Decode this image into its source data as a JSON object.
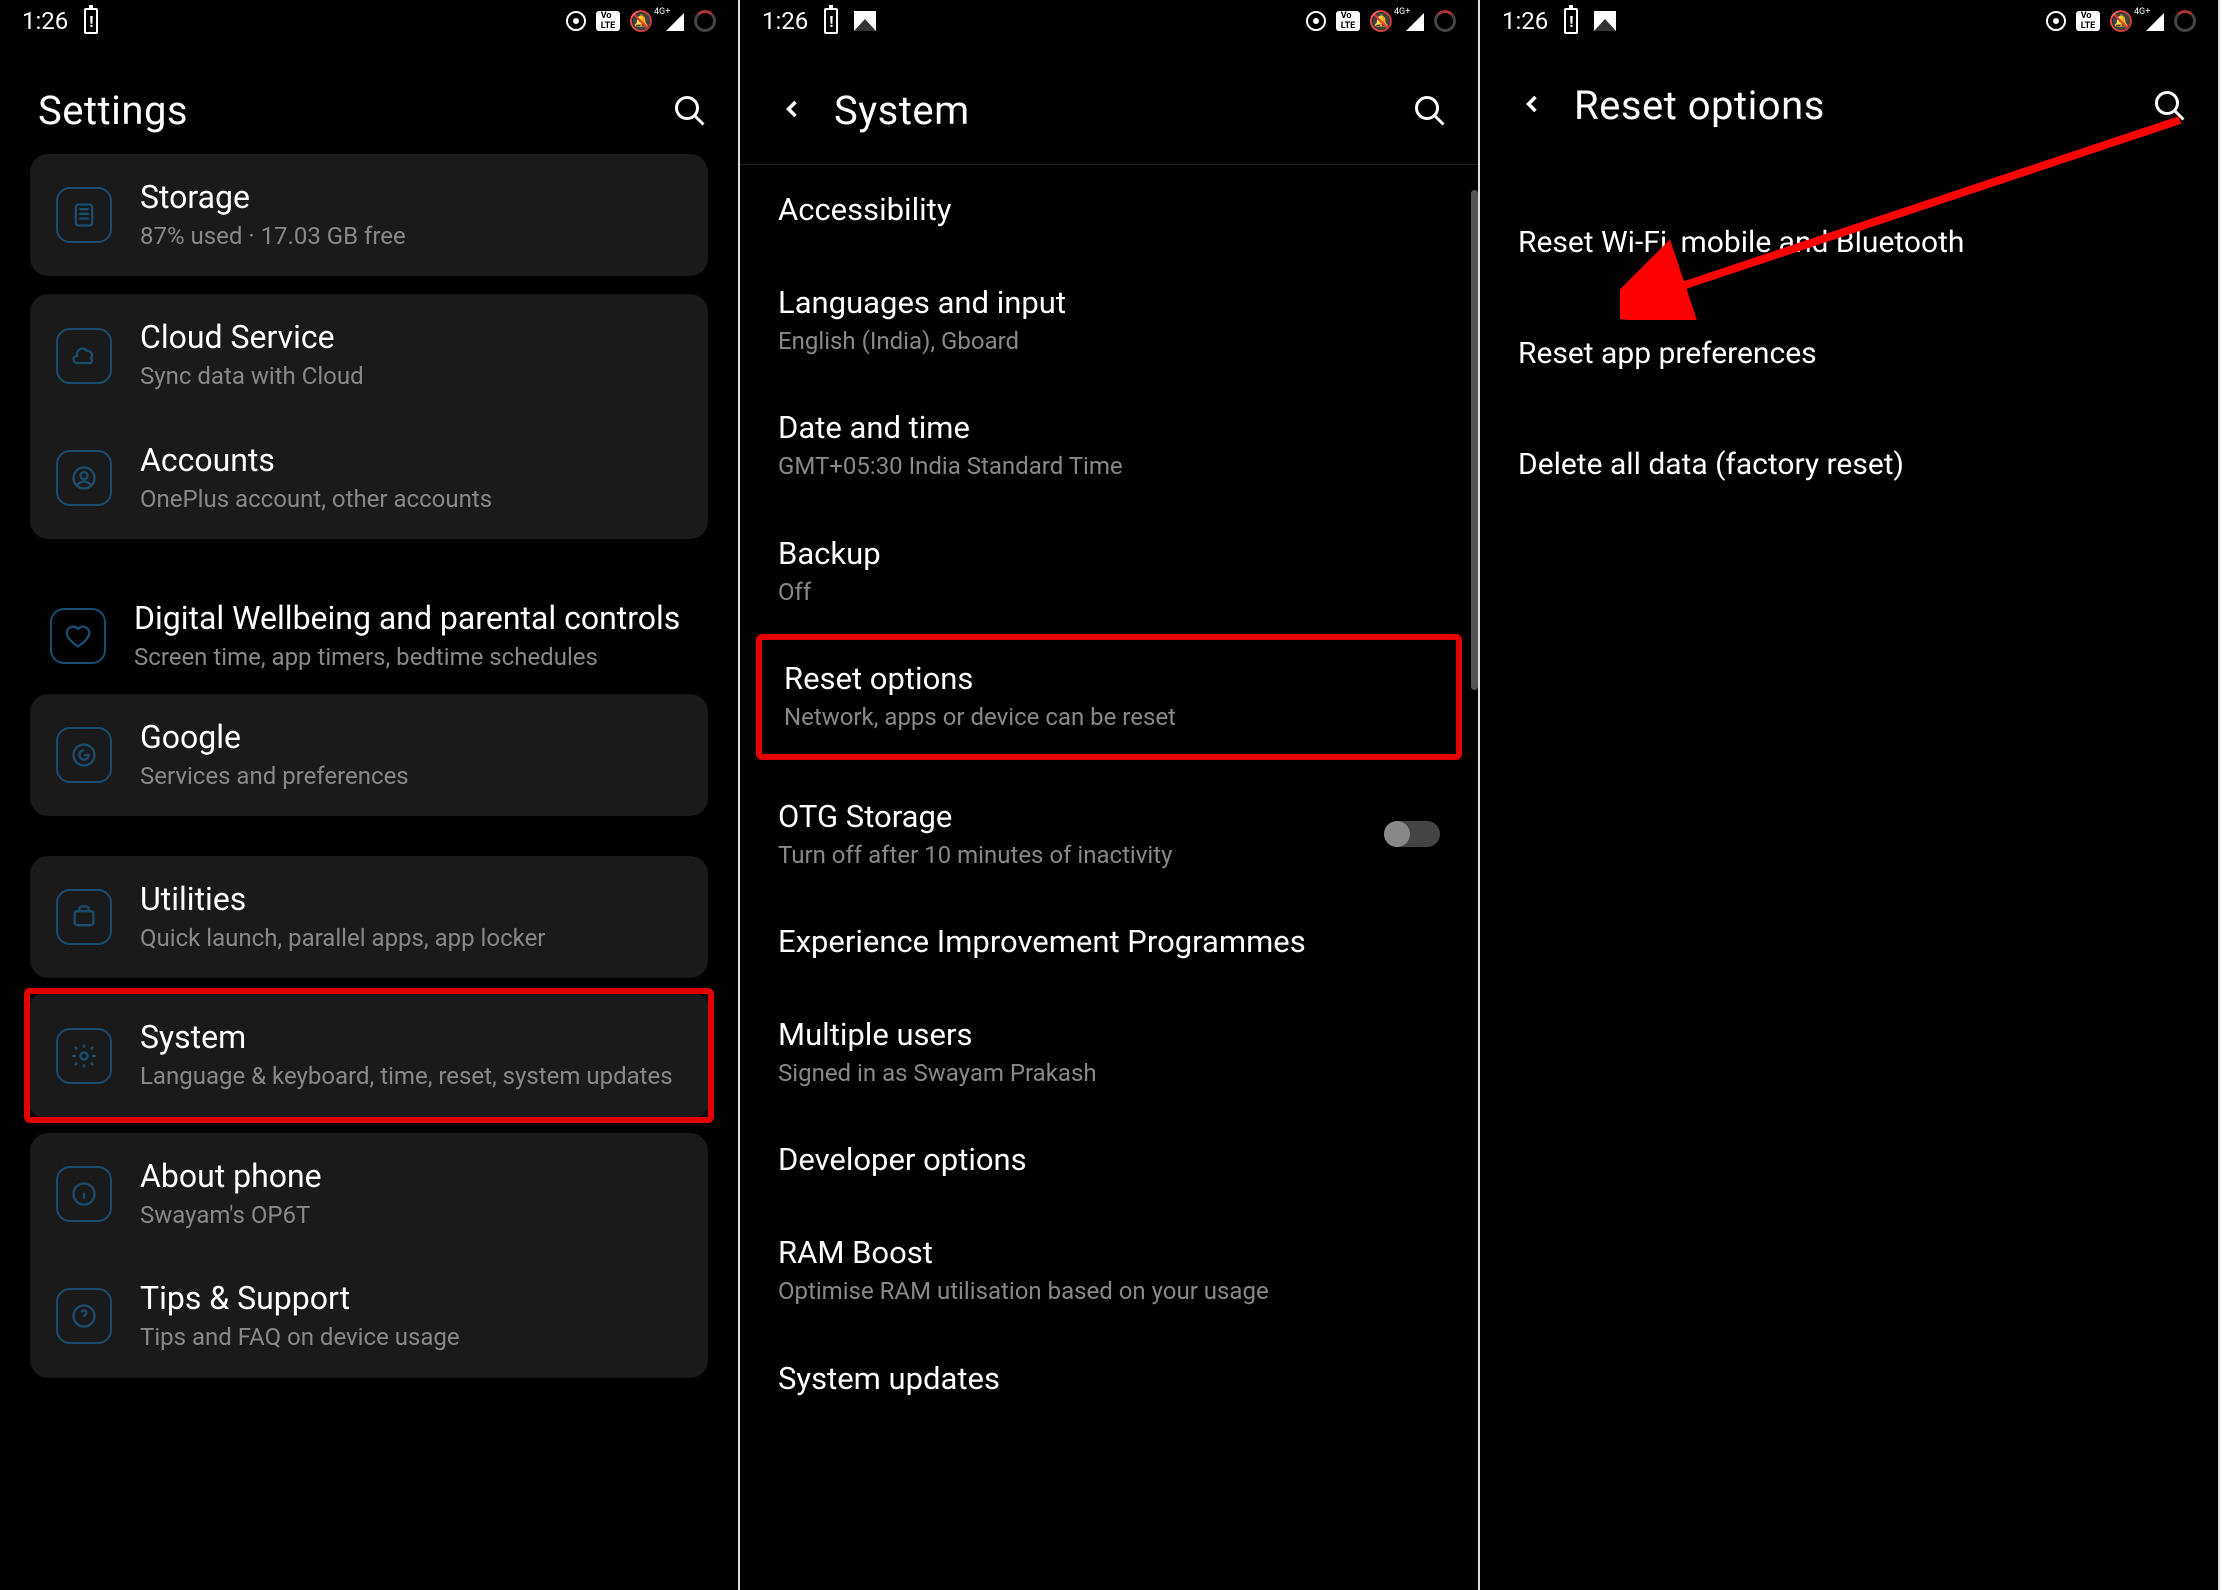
{
  "status_time": "1:26",
  "status": {
    "volte_label": "Vo\nLTE",
    "signal_label": "4G+"
  },
  "screens": {
    "settings": {
      "title": "Settings",
      "items": {
        "storage": {
          "title": "Storage",
          "subtitle": "87% used · 17.03 GB free"
        },
        "cloud": {
          "title": "Cloud Service",
          "subtitle": "Sync data with Cloud"
        },
        "accounts": {
          "title": "Accounts",
          "subtitle": "OnePlus account, other accounts"
        },
        "wellbeing": {
          "title": "Digital Wellbeing and parental controls",
          "subtitle": "Screen time, app timers, bedtime schedules"
        },
        "google": {
          "title": "Google",
          "subtitle": "Services and preferences"
        },
        "utilities": {
          "title": "Utilities",
          "subtitle": "Quick launch, parallel apps, app locker"
        },
        "system": {
          "title": "System",
          "subtitle": "Language & keyboard, time, reset, system updates"
        },
        "about": {
          "title": "About phone",
          "subtitle": "Swayam's OP6T"
        },
        "tips": {
          "title": "Tips & Support",
          "subtitle": "Tips and FAQ on device usage"
        }
      }
    },
    "system": {
      "title": "System",
      "items": {
        "accessibility": {
          "title": "Accessibility"
        },
        "languages": {
          "title": "Languages and input",
          "subtitle": "English (India), Gboard"
        },
        "datetime": {
          "title": "Date and time",
          "subtitle": "GMT+05:30 India Standard Time"
        },
        "backup": {
          "title": "Backup",
          "subtitle": "Off"
        },
        "reset": {
          "title": "Reset options",
          "subtitle": "Network, apps or device can be reset"
        },
        "otg": {
          "title": "OTG Storage",
          "subtitle": "Turn off after 10 minutes of inactivity"
        },
        "experience": {
          "title": "Experience Improvement Programmes"
        },
        "users": {
          "title": "Multiple users",
          "subtitle": "Signed in as Swayam Prakash"
        },
        "developer": {
          "title": "Developer options"
        },
        "ramboost": {
          "title": "RAM Boost",
          "subtitle": "Optimise RAM utilisation based on your usage"
        },
        "updates": {
          "title": "System updates"
        }
      }
    },
    "reset": {
      "title": "Reset options",
      "items": {
        "wifi": {
          "title": "Reset Wi-Fi, mobile and Bluetooth"
        },
        "app": {
          "title": "Reset app preferences"
        },
        "factory": {
          "title": "Delete all data (factory reset)"
        }
      }
    }
  }
}
